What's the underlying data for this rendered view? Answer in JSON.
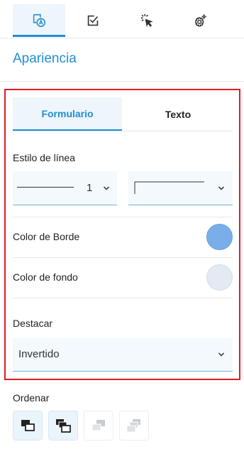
{
  "top_tabs": [
    {
      "name": "appearance",
      "icon": "appearance-icon",
      "active": true
    },
    {
      "name": "validation",
      "icon": "checkbox-icon",
      "active": false
    },
    {
      "name": "actions",
      "icon": "click-icon",
      "active": false
    },
    {
      "name": "settings",
      "icon": "gear-icon",
      "active": false
    }
  ],
  "section": {
    "title": "Apariencia"
  },
  "sub_tabs": {
    "form_label": "Formulario",
    "text_label": "Texto"
  },
  "line_style": {
    "label": "Estilo de línea",
    "width_value": "1"
  },
  "border_color": {
    "label": "Color de Borde",
    "color": "#7aaee8"
  },
  "fill_color": {
    "label": "Color de fondo",
    "color": "#e3eaf3"
  },
  "highlight": {
    "label": "Destacar",
    "value": "Invertido"
  },
  "order": {
    "label": "Ordenar"
  },
  "colors": {
    "accent": "#1f8fd6",
    "highlight_border": "#e01b24"
  }
}
